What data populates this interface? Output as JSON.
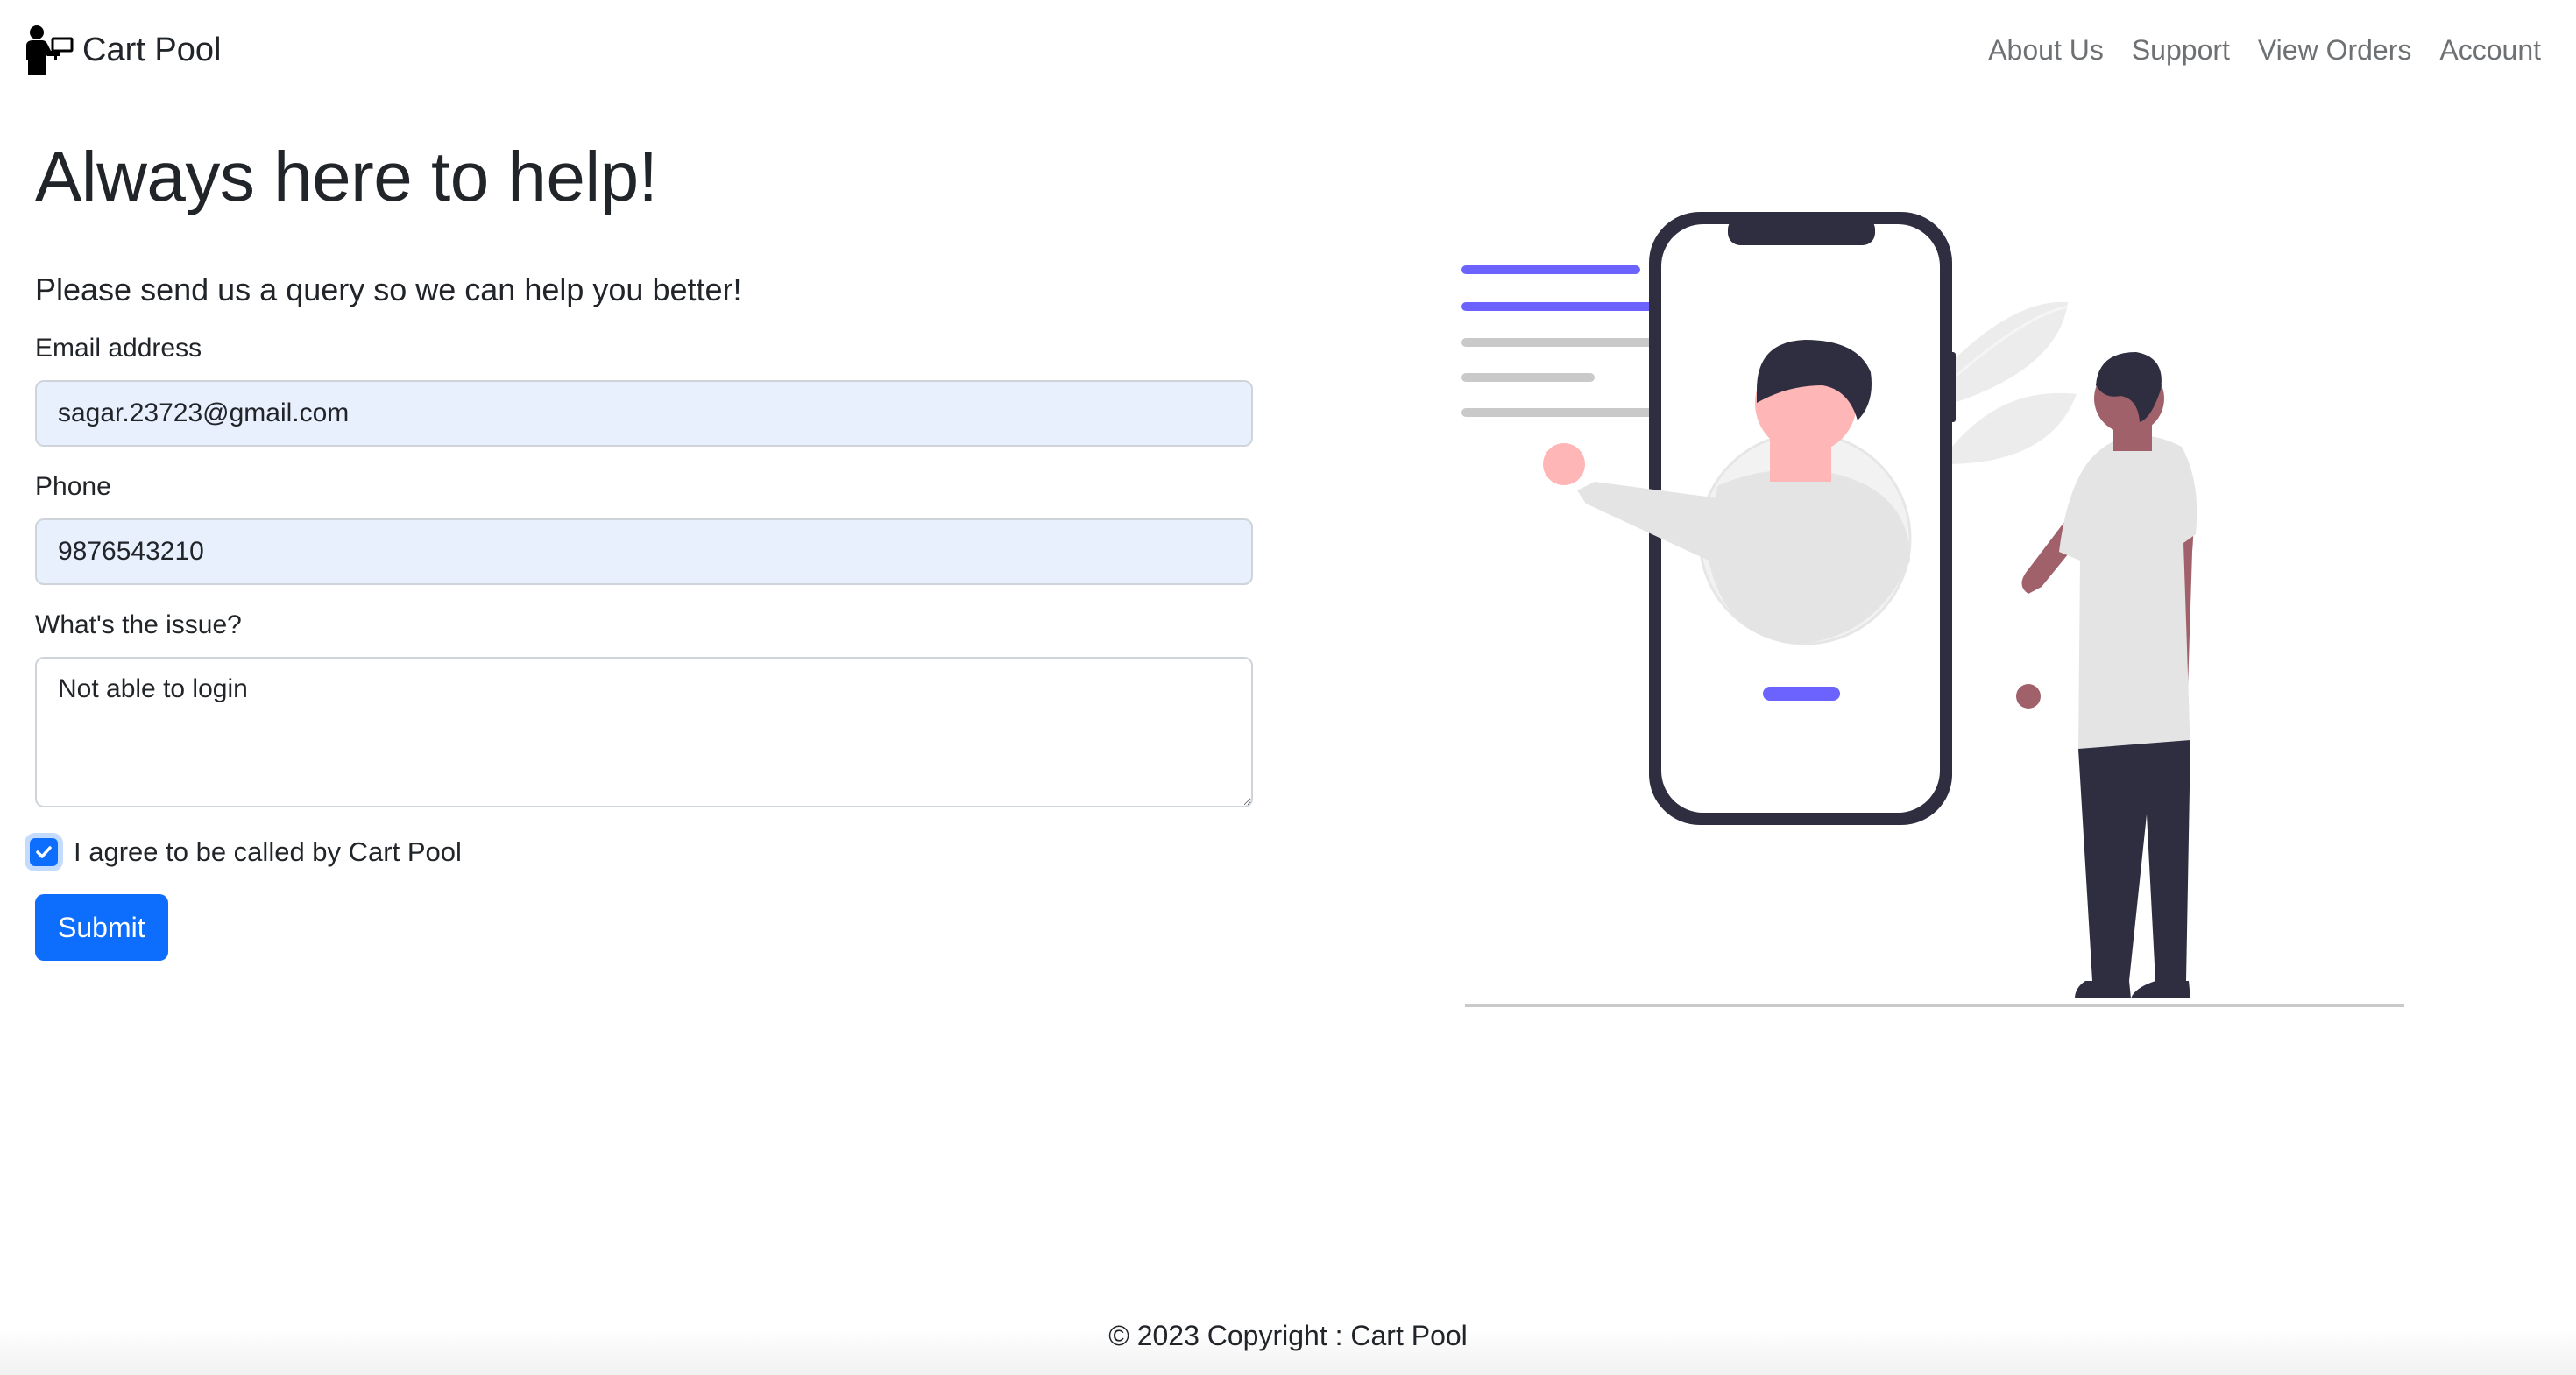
{
  "nav": {
    "brand": "Cart Pool",
    "links": [
      "About Us",
      "Support",
      "View Orders",
      "Account"
    ]
  },
  "main": {
    "title": "Always here to help!",
    "intro": "Please send us a query so we can help you better!",
    "email": {
      "label": "Email address",
      "value": "sagar.23723@gmail.com"
    },
    "phone": {
      "label": "Phone",
      "value": "9876543210"
    },
    "issue": {
      "label": "What's the issue?",
      "value": "Not able to login"
    },
    "consent": {
      "label": "I agree to be called by Cart Pool",
      "checked": true
    },
    "submit_label": "Submit"
  },
  "footer": {
    "text": "© 2023 Copyright : Cart Pool"
  },
  "colors": {
    "primary": "#0d6efd",
    "accent": "#6c63ff",
    "dark": "#2f2e41",
    "skin": "#ffb6b6"
  }
}
